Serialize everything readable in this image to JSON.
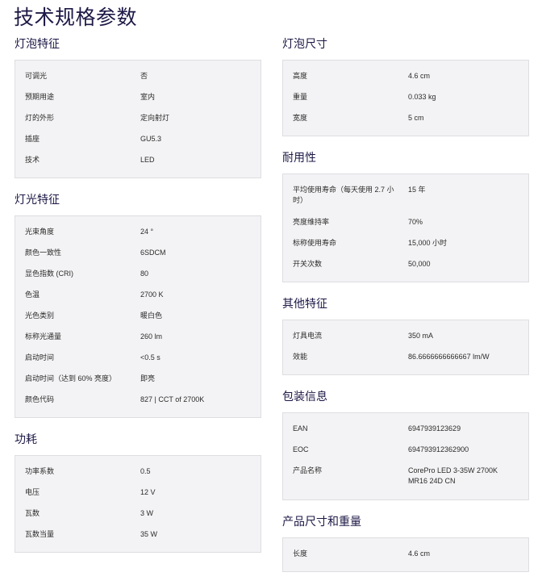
{
  "page_title": "技术规格参数",
  "left": [
    {
      "title": "灯泡特征",
      "rows": [
        {
          "k": "可调光",
          "v": "否"
        },
        {
          "k": "预期用途",
          "v": "室内"
        },
        {
          "k": "灯的外形",
          "v": "定向射灯"
        },
        {
          "k": "插座",
          "v": "GU5.3"
        },
        {
          "k": "技术",
          "v": "LED"
        }
      ]
    },
    {
      "title": "灯光特征",
      "rows": [
        {
          "k": "光束角度",
          "v": "24 °"
        },
        {
          "k": "颜色一致性",
          "v": "6SDCM"
        },
        {
          "k": "显色指数 (CRI)",
          "v": "80"
        },
        {
          "k": "色温",
          "v": "2700 K"
        },
        {
          "k": "光色类别",
          "v": "暖白色"
        },
        {
          "k": "标称光通量",
          "v": "260 lm"
        },
        {
          "k": "启动时间",
          "v": "<0.5 s"
        },
        {
          "k": "启动时间（达到 60% 亮度）",
          "v": "即亮"
        },
        {
          "k": "颜色代码",
          "v": "827 | CCT of 2700K"
        }
      ]
    },
    {
      "title": "功耗",
      "rows": [
        {
          "k": "功率系数",
          "v": "0.5"
        },
        {
          "k": "电压",
          "v": "12 V"
        },
        {
          "k": "瓦数",
          "v": "3 W"
        },
        {
          "k": "瓦数当量",
          "v": "35 W"
        }
      ]
    }
  ],
  "right": [
    {
      "title": "灯泡尺寸",
      "rows": [
        {
          "k": "高度",
          "v": "4.6 cm"
        },
        {
          "k": "重量",
          "v": "0.033 kg"
        },
        {
          "k": "宽度",
          "v": "5 cm"
        }
      ]
    },
    {
      "title": "耐用性",
      "rows": [
        {
          "k": "平均使用寿命（每天使用 2.7 小时）",
          "v": "15 年"
        },
        {
          "k": "亮度维持率",
          "v": "70%"
        },
        {
          "k": "标称使用寿命",
          "v": "15,000 小时"
        },
        {
          "k": "开关次数",
          "v": "50,000"
        }
      ]
    },
    {
      "title": "其他特征",
      "rows": [
        {
          "k": "灯具电流",
          "v": "350 mA"
        },
        {
          "k": "效能",
          "v": "86.6666666666667 lm/W"
        }
      ]
    },
    {
      "title": "包装信息",
      "rows": [
        {
          "k": "EAN",
          "v": "6947939123629"
        },
        {
          "k": "EOC",
          "v": "694793912362900"
        },
        {
          "k": "产品名称",
          "v": "CorePro LED 3-35W 2700K MR16 24D CN"
        }
      ]
    },
    {
      "title": "产品尺寸和重量",
      "rows": [
        {
          "k": "长度",
          "v": "4.6 cm"
        }
      ]
    }
  ]
}
